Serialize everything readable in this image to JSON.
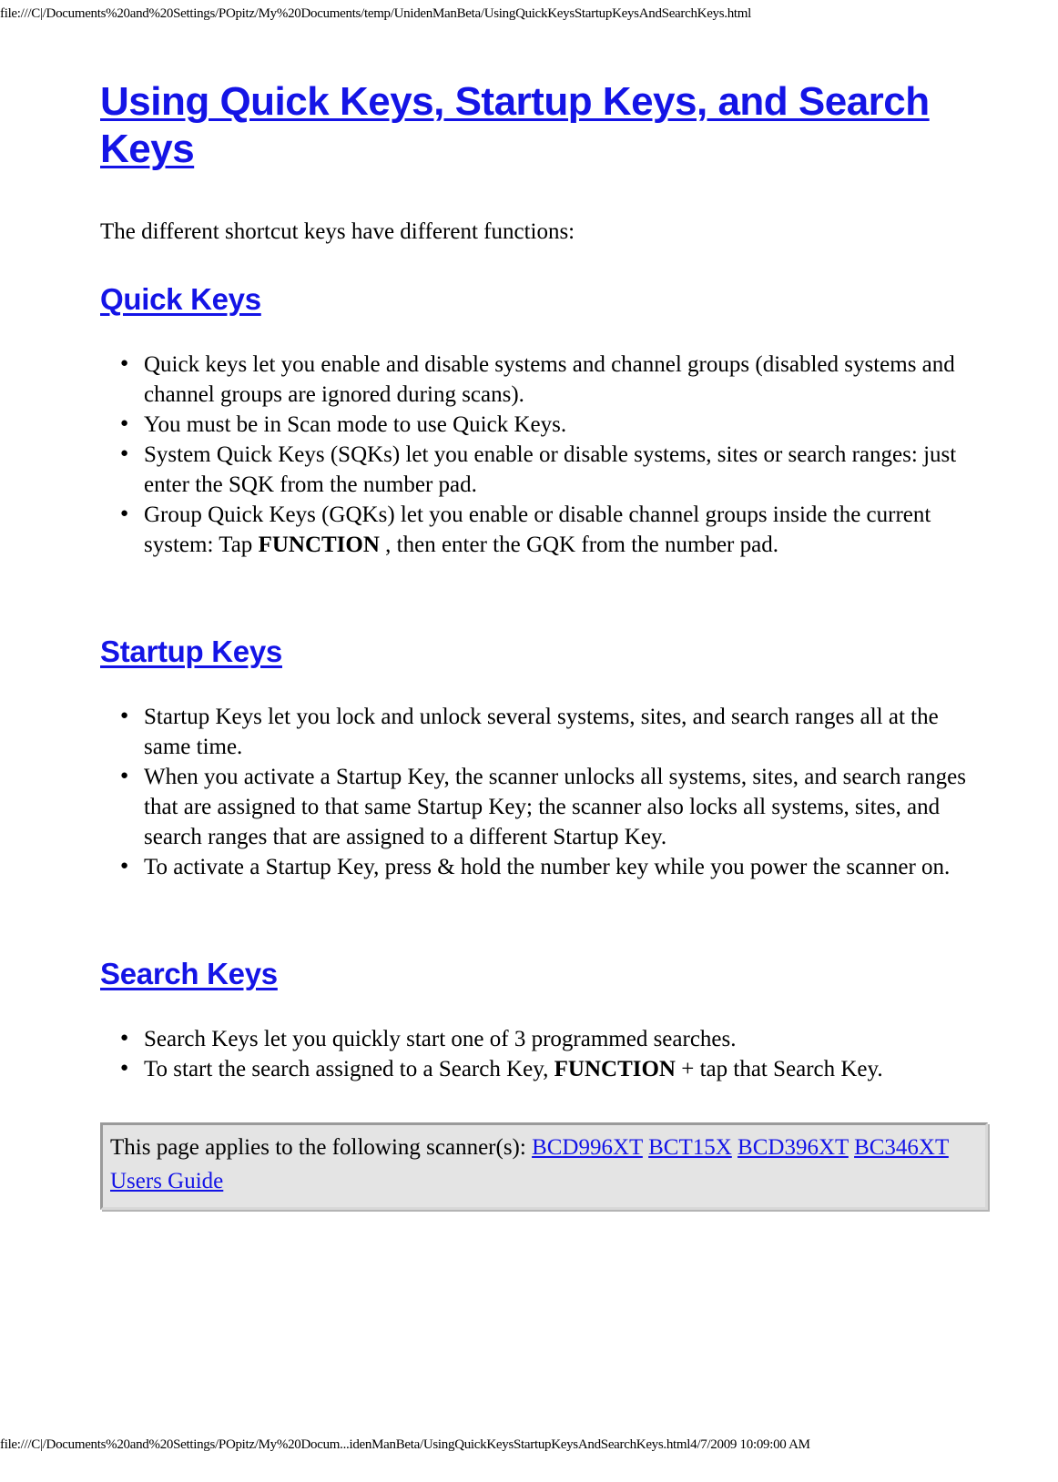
{
  "browser_print": {
    "header_url": "file:///C|/Documents%20and%20Settings/POpitz/My%20Documents/temp/UnidenManBeta/UsingQuickKeysStartupKeysAndSearchKeys.html",
    "footer_url": "file:///C|/Documents%20and%20Settings/POpitz/My%20Docum...idenManBeta/UsingQuickKeysStartupKeysAndSearchKeys.html4/7/2009 10:09:00 AM"
  },
  "colors": {
    "link_blue": "#1414e6",
    "box_background": "#e4e4e4",
    "text_black": "#000000"
  },
  "document": {
    "title": "Using Quick Keys, Startup Keys, and Search Keys",
    "intro": "The different shortcut keys have different functions:",
    "sections": [
      {
        "heading": "Quick Keys",
        "bullets": [
          {
            "parts": [
              {
                "text": "Quick keys let you enable and disable systems and channel groups (disabled systems and channel groups are ignored during scans).",
                "bold": false
              }
            ]
          },
          {
            "parts": [
              {
                "text": "You must be in Scan mode to use Quick Keys.",
                "bold": false
              }
            ]
          },
          {
            "parts": [
              {
                "text": "System Quick Keys (SQKs) let you enable or disable systems, sites or search ranges: just enter the SQK from the number pad.",
                "bold": false
              }
            ]
          },
          {
            "parts": [
              {
                "text": "Group Quick Keys (GQKs) let you enable or disable channel groups inside the current system: Tap ",
                "bold": false
              },
              {
                "text": "FUNCTION",
                "bold": true
              },
              {
                "text": " , then enter the GQK from the number pad.",
                "bold": false
              }
            ]
          }
        ]
      },
      {
        "heading": "Startup Keys",
        "bullets": [
          {
            "parts": [
              {
                "text": "Startup Keys let you lock and unlock several systems, sites, and search ranges all at the same time.",
                "bold": false
              }
            ]
          },
          {
            "parts": [
              {
                "text": "When you activate a Startup Key, the scanner unlocks all systems, sites, and search ranges that are assigned to that same Startup Key; the scanner also locks all systems, sites, and search ranges that are assigned to a different Startup Key.",
                "bold": false
              }
            ]
          },
          {
            "parts": [
              {
                "text": "To activate a Startup Key, press & hold the number key while you power the scanner on.",
                "bold": false
              }
            ]
          }
        ]
      },
      {
        "heading": "Search Keys",
        "bullets": [
          {
            "parts": [
              {
                "text": "Search Keys let you quickly start one of 3 programmed searches.",
                "bold": false
              }
            ]
          },
          {
            "parts": [
              {
                "text": "To start the search assigned to a Search Key, ",
                "bold": false
              },
              {
                "text": "FUNCTION",
                "bold": true
              },
              {
                "text": " + tap that Search Key.",
                "bold": false
              }
            ]
          }
        ]
      }
    ],
    "applies_box": {
      "lead_text": "This page applies to the following scanner(s): ",
      "links": [
        "BCD996XT",
        "BCT15X",
        "BCD396XT",
        "BC346XT",
        "Users Guide"
      ]
    }
  }
}
